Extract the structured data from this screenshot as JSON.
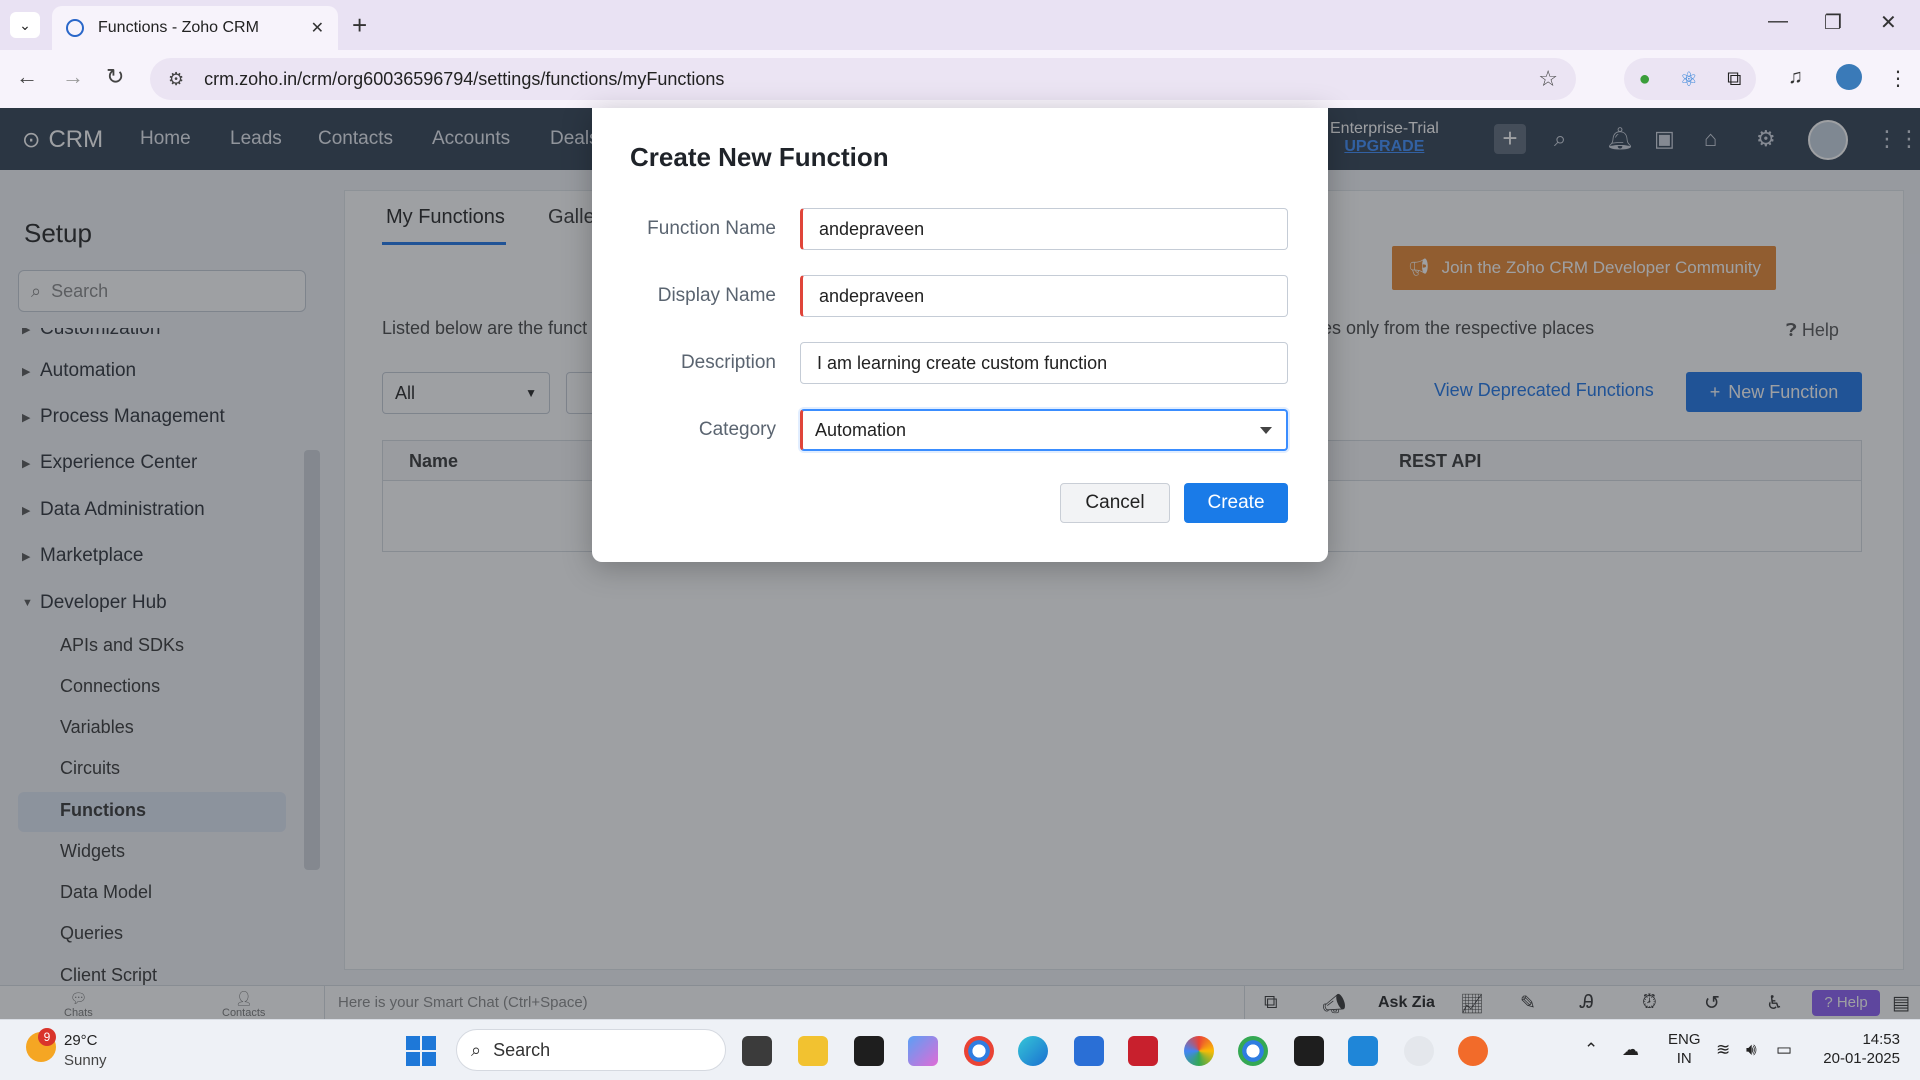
{
  "browser": {
    "tab_title": "Functions - Zoho CRM",
    "url": "crm.zoho.in/crm/org60036596794/settings/functions/myFunctions"
  },
  "crm": {
    "logo": "CRM",
    "nav": [
      "Home",
      "Leads",
      "Contacts",
      "Accounts",
      "Deals"
    ],
    "trial_label": "Enterprise-Trial",
    "upgrade_label": "UPGRADE"
  },
  "sidebar": {
    "title": "Setup",
    "search_placeholder": "Search",
    "sections": [
      "Customization",
      "Automation",
      "Process Management",
      "Experience Center",
      "Data Administration",
      "Marketplace",
      "Developer Hub"
    ],
    "sub_items": [
      "APIs and SDKs",
      "Connections",
      "Variables",
      "Circuits",
      "Functions",
      "Widgets",
      "Data Model",
      "Queries",
      "Client Script"
    ],
    "active_item": "Functions"
  },
  "content": {
    "tab_active": "My Functions",
    "tab_other": "Galle",
    "join_label": "Join the Zoho CRM Developer Community",
    "listed_left": "Listed below are the funct",
    "listed_right": "es only from the respective places",
    "help_label": "Help",
    "filter_value": "All",
    "view_deprecated": "View Deprecated Functions",
    "new_function": "New Function",
    "col_name": "Name",
    "col_rest": "REST API"
  },
  "modal": {
    "title": "Create New Function",
    "function_name_label": "Function Name",
    "function_name_value": "andepraveen",
    "display_name_label": "Display Name",
    "display_name_value": "andepraveen",
    "description_label": "Description",
    "description_value": "I am learning create custom function",
    "category_label": "Category",
    "category_value": "Automation",
    "cancel_label": "Cancel",
    "create_label": "Create"
  },
  "bottombar": {
    "chats": "Chats",
    "contacts": "Contacts",
    "smart_chat": "Here is your Smart Chat (Ctrl+Space)",
    "ask_zia": "Ask Zia",
    "help": "Help"
  },
  "taskbar": {
    "weather_badge": "9",
    "temperature": "29°C",
    "condition": "Sunny",
    "search_label": "Search",
    "lang_1": "ENG",
    "lang_2": "IN",
    "time": "14:53",
    "date": "20-01-2025"
  },
  "colors": {
    "accent": "#1a73e8",
    "crm_header": "#2f3e50",
    "join_orange": "#e8862e",
    "required_red": "#e0453a"
  }
}
